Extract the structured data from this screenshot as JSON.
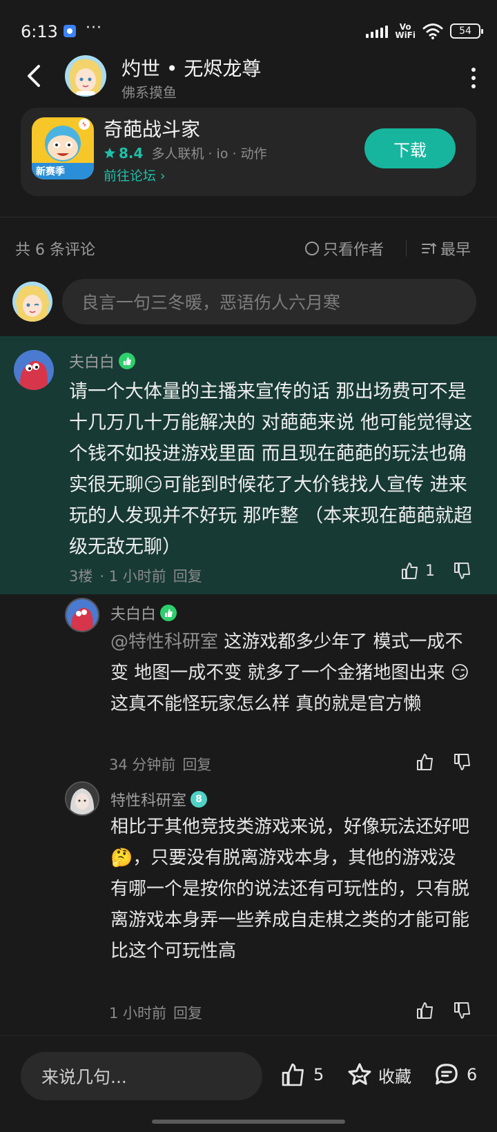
{
  "status": {
    "time": "6:13",
    "dots": "···",
    "vowifi_top": "Vo",
    "vowifi_bottom": "WiFi",
    "battery": "54"
  },
  "header": {
    "title": "灼世 • 无烬龙尊",
    "subtitle": "佛系摸鱼"
  },
  "game": {
    "name": "奇葩战斗家",
    "score": "8.4",
    "tags": "多人联机 · io · 动作",
    "forum_link": "前往论坛 ›",
    "download_label": "下载",
    "icon_badge": "新赛季",
    "accent": "#17b59d"
  },
  "comments_bar": {
    "count_label": "共 6 条评论",
    "filter_author": "只看作者",
    "sort_label": "最早"
  },
  "compose": {
    "placeholder": "良言一句三冬暖，恶语伤人六月寒"
  },
  "main_comment": {
    "user": "夫白白",
    "text": "请一个大体量的主播来宣传的话 那出场费可不是十几万几十万能解决的 对葩葩来说 他可能觉得这个钱不如投进游戏里面 而且现在葩葩的玩法也确实很无聊😏可能到时候花了大价钱找人宣传 进来玩的人发现并不好玩 那咋整 （本来现在葩葩就超级无敌无聊）",
    "floor": "3楼",
    "time": "· 1 小时前",
    "reply_label": "回复",
    "likes": "1",
    "highlight_color": "#173a34"
  },
  "replies": [
    {
      "user": "夫白白",
      "mention": "@特性科研室",
      "text": "  这游戏都多少年了  模式一成不变 地图一成不变 就多了一个金猪地图出来  😏  这真不能怪玩家怎么样 真的就是官方懒",
      "time": "34 分钟前",
      "reply_label": "回复"
    },
    {
      "user": "特性科研室",
      "level": "8",
      "text": "相比于其他竞技类游戏来说，好像玩法还好吧🤔，只要没有脱离游戏本身，其他的游戏没有哪一个是按你的说法还有可玩性的，只有脱离游戏本身弄一些养成自走棋之类的才能可能比这个可玩性高",
      "time": "1 小时前",
      "reply_label": "回复"
    }
  ],
  "bottom": {
    "input_placeholder": "来说几句...",
    "likes": "5",
    "fav_label": "收藏",
    "comments": "6"
  }
}
